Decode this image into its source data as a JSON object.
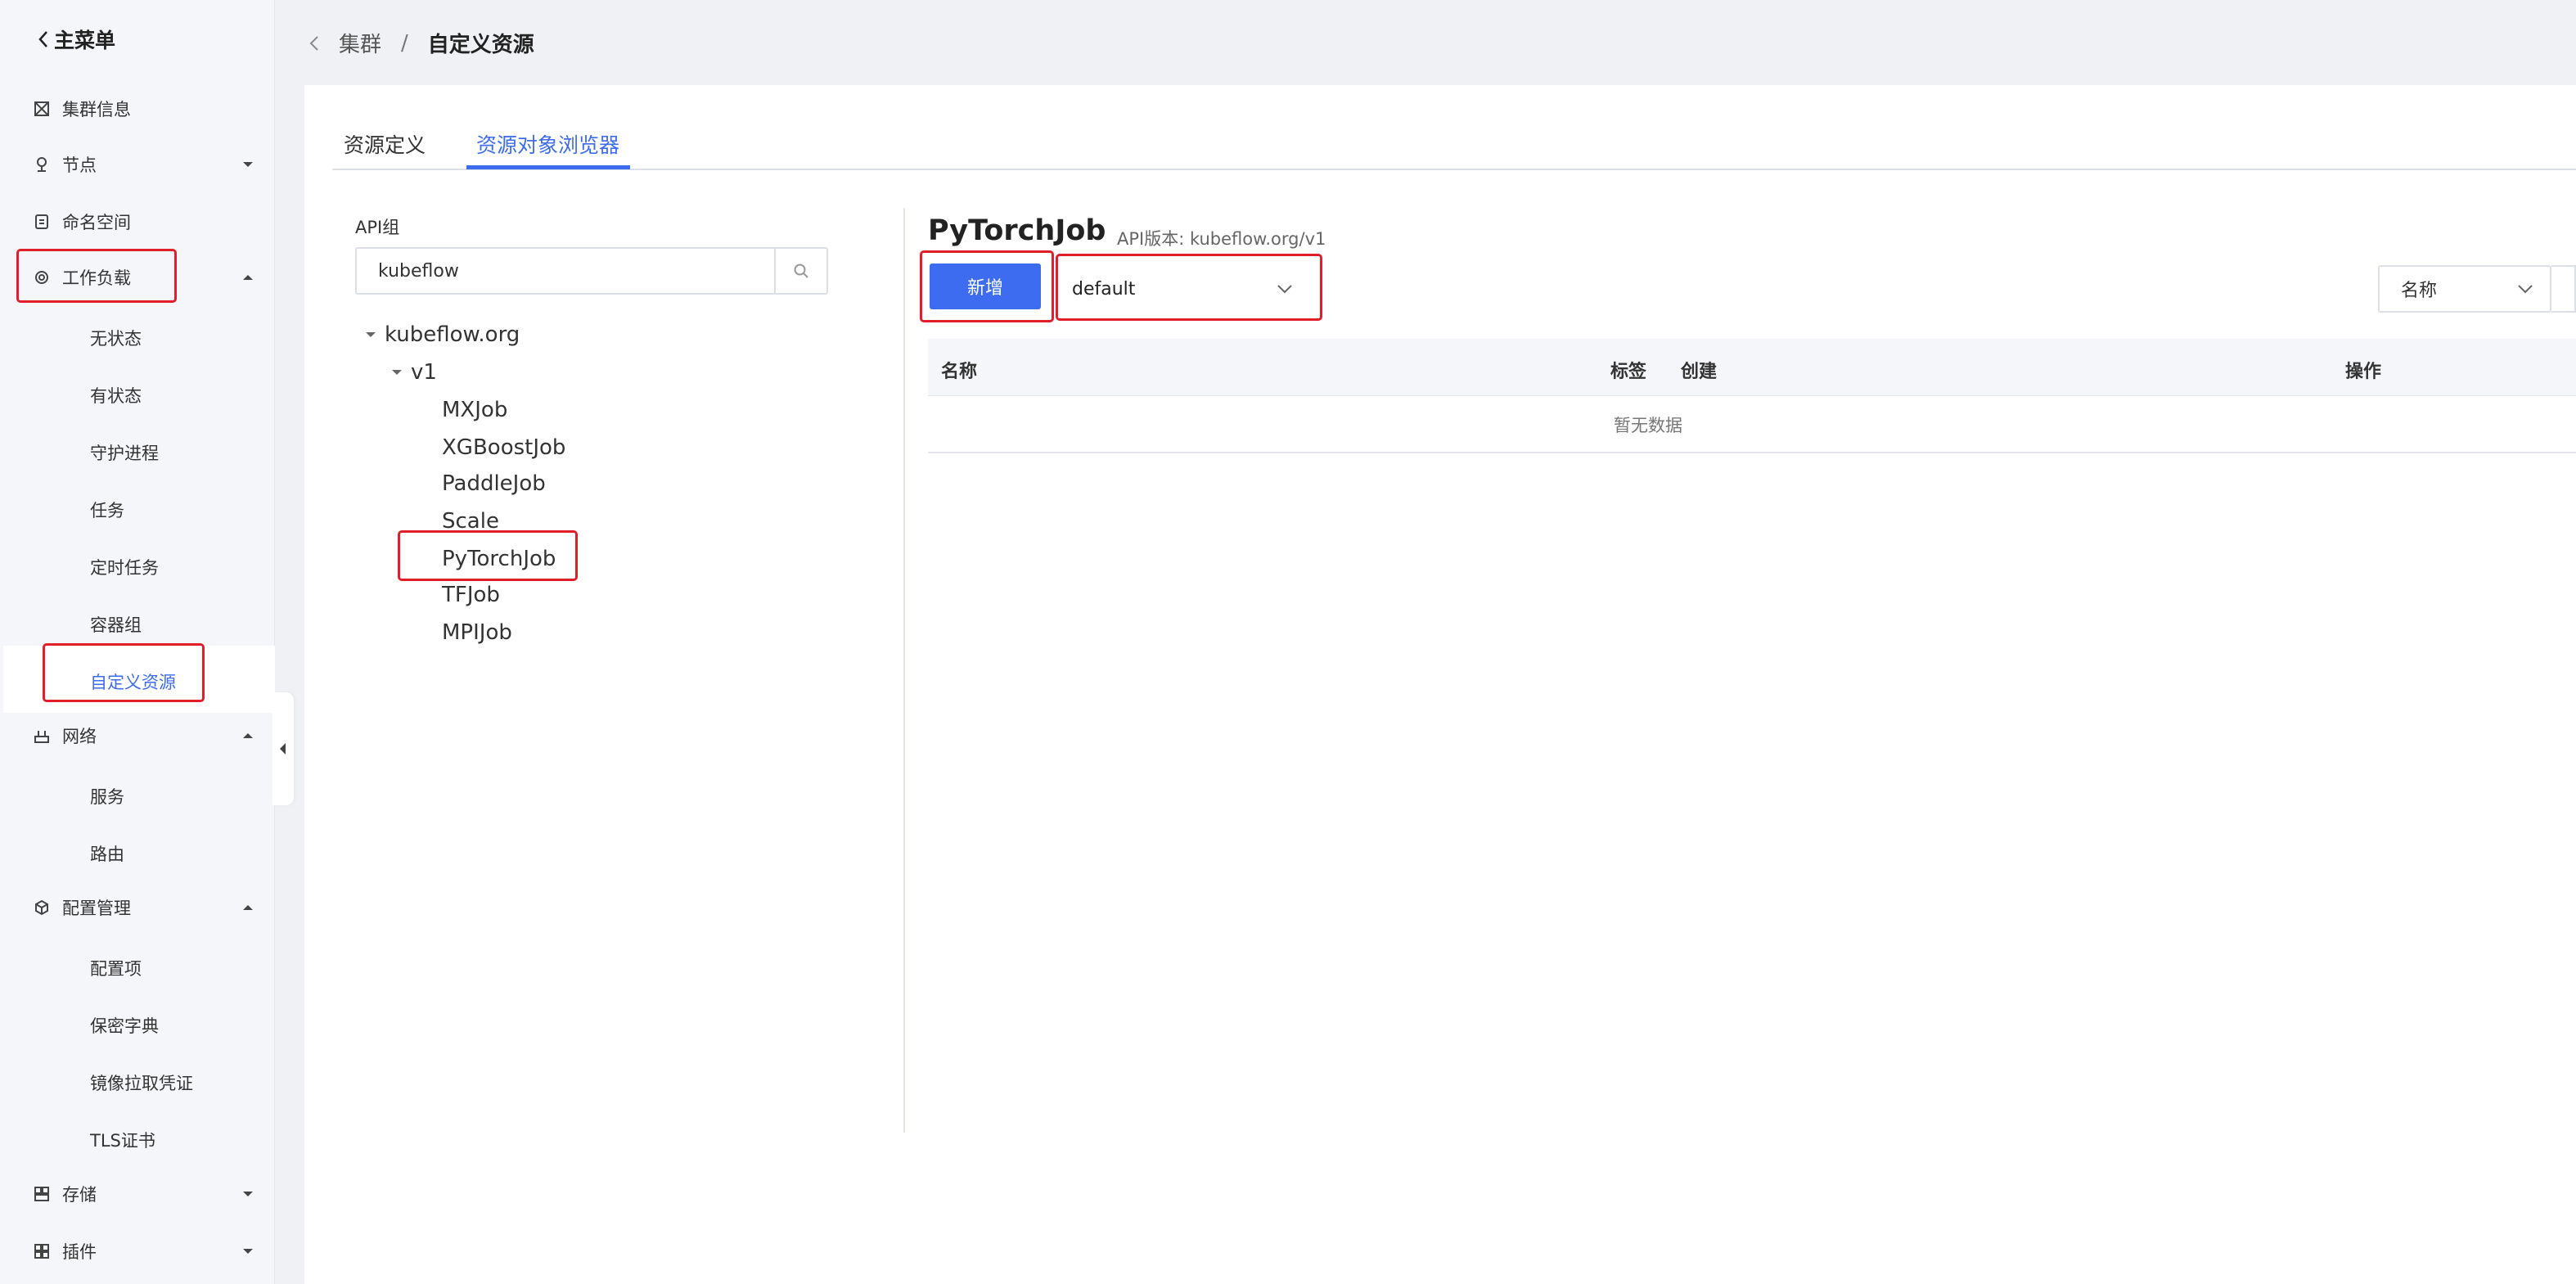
{
  "sidebar": {
    "back_label": "主菜单",
    "items": [
      {
        "label": "集群信息",
        "icon": "cluster-icon"
      },
      {
        "label": "节点",
        "icon": "node-icon"
      },
      {
        "label": "命名空间",
        "icon": "namespace-icon"
      },
      {
        "label": "工作负载",
        "icon": "workload-icon"
      },
      {
        "label": "网络",
        "icon": "network-icon"
      },
      {
        "label": "配置管理",
        "icon": "config-icon"
      },
      {
        "label": "存储",
        "icon": "storage-icon"
      },
      {
        "label": "插件",
        "icon": "plugin-icon"
      }
    ],
    "workload_sub": [
      "无状态",
      "有状态",
      "守护进程",
      "任务",
      "定时任务",
      "容器组",
      "自定义资源"
    ],
    "network_sub": [
      "服务",
      "路由"
    ],
    "config_sub": [
      "配置项",
      "保密字典",
      "镜像拉取凭证",
      "TLS证书"
    ],
    "active_item": "自定义资源"
  },
  "breadcrumb": {
    "parent": "集群",
    "separator": "/",
    "current": "自定义资源"
  },
  "tabs": [
    {
      "label": "资源定义",
      "active": false
    },
    {
      "label": "资源对象浏览器",
      "active": true
    }
  ],
  "api_group": {
    "label": "API组",
    "value": "kubeflow"
  },
  "tree": {
    "group": "kubeflow.org",
    "version": "v1",
    "kinds": [
      "MXJob",
      "XGBoostJob",
      "PaddleJob",
      "Scale",
      "PyTorchJob",
      "TFJob",
      "MPIJob"
    ],
    "selected": "PyTorchJob"
  },
  "resource": {
    "title": "PyTorchJob",
    "api_version": "API版本: kubeflow.org/v1",
    "add_button": "新增",
    "namespace": "default",
    "filter_field": "名称"
  },
  "table": {
    "columns": [
      "名称",
      "标签",
      "创建",
      "操作"
    ],
    "empty_text": "暂无数据"
  },
  "colors": {
    "accent": "#3e6cf0",
    "highlight_box": "#e01f2a"
  }
}
